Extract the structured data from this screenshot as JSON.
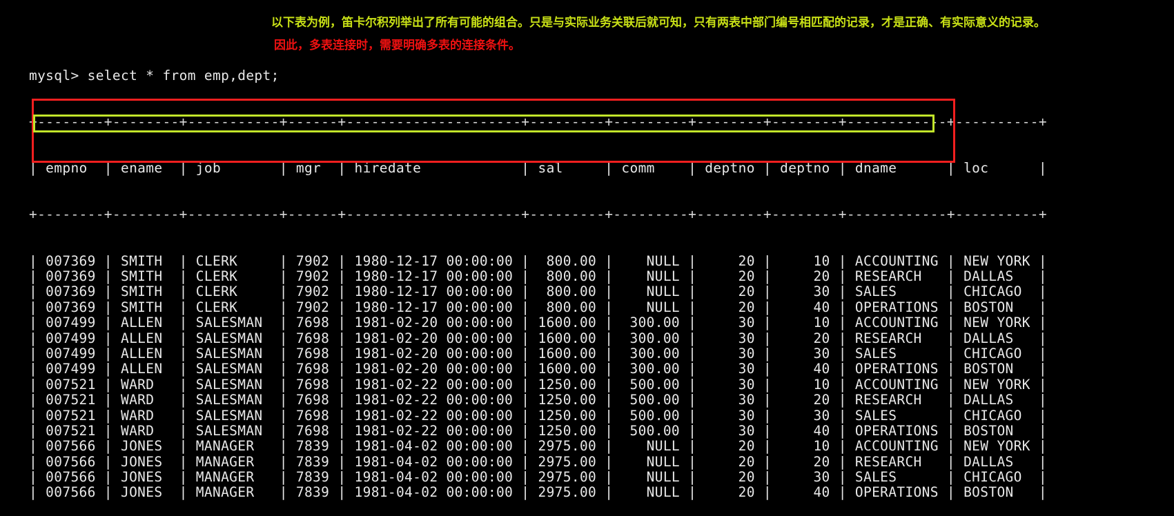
{
  "annotations": {
    "yellow_note": "以下表为例，笛卡尔积列举出了所有可能的组合。只是与实际业务关联后就可知，只有两表中部门编号相匹配的记录，才是正确、有实际意义的记录。",
    "yellow_color": "#c8e016",
    "red_note": "因此，多表连接时，需要明确多表的连接条件。",
    "red_color": "#ee1111"
  },
  "terminal": {
    "prompt": "mysql> ",
    "command": "select * from emp,dept;",
    "prompt_line": "mysql> select * from emp,dept;",
    "separator": "+--------+--------+-----------+------+---------------------+---------+---------+--------+--------+------------+----------+",
    "header_line": "| empno  | ename  | job       | mgr  | hiredate            | sal     | comm    | deptno | deptno | dname      | loc      |",
    "columns": [
      "empno",
      "ename",
      "job",
      "mgr",
      "hiredate",
      "sal",
      "comm",
      "deptno",
      "deptno",
      "dname",
      "loc"
    ],
    "rows": [
      {
        "empno": "007369",
        "ename": "SMITH",
        "job": "CLERK",
        "mgr": "7902",
        "hiredate": "1980-12-17 00:00:00",
        "sal": "800.00",
        "comm": "NULL",
        "deptno_emp": "20",
        "deptno_dept": "10",
        "dname": "ACCOUNTING",
        "loc": "NEW YORK"
      },
      {
        "empno": "007369",
        "ename": "SMITH",
        "job": "CLERK",
        "mgr": "7902",
        "hiredate": "1980-12-17 00:00:00",
        "sal": "800.00",
        "comm": "NULL",
        "deptno_emp": "20",
        "deptno_dept": "20",
        "dname": "RESEARCH",
        "loc": "DALLAS"
      },
      {
        "empno": "007369",
        "ename": "SMITH",
        "job": "CLERK",
        "mgr": "7902",
        "hiredate": "1980-12-17 00:00:00",
        "sal": "800.00",
        "comm": "NULL",
        "deptno_emp": "20",
        "deptno_dept": "30",
        "dname": "SALES",
        "loc": "CHICAGO"
      },
      {
        "empno": "007369",
        "ename": "SMITH",
        "job": "CLERK",
        "mgr": "7902",
        "hiredate": "1980-12-17 00:00:00",
        "sal": "800.00",
        "comm": "NULL",
        "deptno_emp": "20",
        "deptno_dept": "40",
        "dname": "OPERATIONS",
        "loc": "BOSTON"
      },
      {
        "empno": "007499",
        "ename": "ALLEN",
        "job": "SALESMAN",
        "mgr": "7698",
        "hiredate": "1981-02-20 00:00:00",
        "sal": "1600.00",
        "comm": "300.00",
        "deptno_emp": "30",
        "deptno_dept": "10",
        "dname": "ACCOUNTING",
        "loc": "NEW YORK"
      },
      {
        "empno": "007499",
        "ename": "ALLEN",
        "job": "SALESMAN",
        "mgr": "7698",
        "hiredate": "1981-02-20 00:00:00",
        "sal": "1600.00",
        "comm": "300.00",
        "deptno_emp": "30",
        "deptno_dept": "20",
        "dname": "RESEARCH",
        "loc": "DALLAS"
      },
      {
        "empno": "007499",
        "ename": "ALLEN",
        "job": "SALESMAN",
        "mgr": "7698",
        "hiredate": "1981-02-20 00:00:00",
        "sal": "1600.00",
        "comm": "300.00",
        "deptno_emp": "30",
        "deptno_dept": "30",
        "dname": "SALES",
        "loc": "CHICAGO"
      },
      {
        "empno": "007499",
        "ename": "ALLEN",
        "job": "SALESMAN",
        "mgr": "7698",
        "hiredate": "1981-02-20 00:00:00",
        "sal": "1600.00",
        "comm": "300.00",
        "deptno_emp": "30",
        "deptno_dept": "40",
        "dname": "OPERATIONS",
        "loc": "BOSTON"
      },
      {
        "empno": "007521",
        "ename": "WARD",
        "job": "SALESMAN",
        "mgr": "7698",
        "hiredate": "1981-02-22 00:00:00",
        "sal": "1250.00",
        "comm": "500.00",
        "deptno_emp": "30",
        "deptno_dept": "10",
        "dname": "ACCOUNTING",
        "loc": "NEW YORK"
      },
      {
        "empno": "007521",
        "ename": "WARD",
        "job": "SALESMAN",
        "mgr": "7698",
        "hiredate": "1981-02-22 00:00:00",
        "sal": "1250.00",
        "comm": "500.00",
        "deptno_emp": "30",
        "deptno_dept": "20",
        "dname": "RESEARCH",
        "loc": "DALLAS"
      },
      {
        "empno": "007521",
        "ename": "WARD",
        "job": "SALESMAN",
        "mgr": "7698",
        "hiredate": "1981-02-22 00:00:00",
        "sal": "1250.00",
        "comm": "500.00",
        "deptno_emp": "30",
        "deptno_dept": "30",
        "dname": "SALES",
        "loc": "CHICAGO"
      },
      {
        "empno": "007521",
        "ename": "WARD",
        "job": "SALESMAN",
        "mgr": "7698",
        "hiredate": "1981-02-22 00:00:00",
        "sal": "1250.00",
        "comm": "500.00",
        "deptno_emp": "30",
        "deptno_dept": "40",
        "dname": "OPERATIONS",
        "loc": "BOSTON"
      },
      {
        "empno": "007566",
        "ename": "JONES",
        "job": "MANAGER",
        "mgr": "7839",
        "hiredate": "1981-04-02 00:00:00",
        "sal": "2975.00",
        "comm": "NULL",
        "deptno_emp": "20",
        "deptno_dept": "10",
        "dname": "ACCOUNTING",
        "loc": "NEW YORK"
      },
      {
        "empno": "007566",
        "ename": "JONES",
        "job": "MANAGER",
        "mgr": "7839",
        "hiredate": "1981-04-02 00:00:00",
        "sal": "2975.00",
        "comm": "NULL",
        "deptno_emp": "20",
        "deptno_dept": "20",
        "dname": "RESEARCH",
        "loc": "DALLAS"
      },
      {
        "empno": "007566",
        "ename": "JONES",
        "job": "MANAGER",
        "mgr": "7839",
        "hiredate": "1981-04-02 00:00:00",
        "sal": "2975.00",
        "comm": "NULL",
        "deptno_emp": "20",
        "deptno_dept": "30",
        "dname": "SALES",
        "loc": "CHICAGO"
      },
      {
        "empno": "007566",
        "ename": "JONES",
        "job": "MANAGER",
        "mgr": "7839",
        "hiredate": "1981-04-02 00:00:00",
        "sal": "2975.00",
        "comm": "NULL",
        "deptno_emp": "20",
        "deptno_dept": "40",
        "dname": "OPERATIONS",
        "loc": "BOSTON"
      }
    ]
  },
  "highlights": {
    "red_box_color": "#f41f1f",
    "red_box_rows": "rows 1-4 (SMITH cartesian block)",
    "green_box_color": "#c2e52a",
    "green_box_rows": "row 2 (SMITH / deptno 20 = deptno 20 / RESEARCH / DALLAS)"
  }
}
